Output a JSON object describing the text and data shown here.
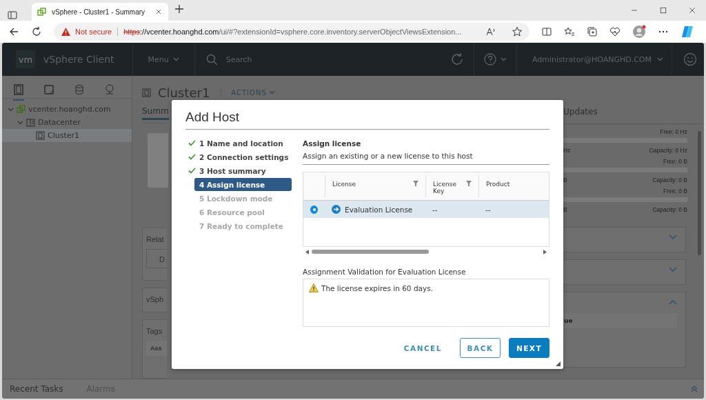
{
  "browser": {
    "tab": {
      "title": "vSphere - Cluster1 - Summary"
    },
    "security": "Not secure",
    "url": {
      "scheme": "https",
      "host": "://vcenter.hoanghd.com",
      "path": "/ui/#?extensionId=vsphere.core.inventory.serverObjectViewsExtension..."
    }
  },
  "header": {
    "logo": "vm",
    "product": "vSphere Client",
    "menu": "Menu",
    "search_placeholder": "Search",
    "user": "Administrator@HOANGHD.COM"
  },
  "nav_icons": [
    {
      "kind": "hosts",
      "selected": true
    },
    {
      "kind": "vms",
      "selected": false
    },
    {
      "kind": "storage",
      "selected": false
    },
    {
      "kind": "network",
      "selected": false
    }
  ],
  "tree": [
    {
      "label": "vcenter.hoanghd.com",
      "kind": "vcenter",
      "expanded": true,
      "selected": false,
      "children": [
        {
          "label": "Datacenter",
          "kind": "datacenter",
          "expanded": true,
          "selected": false,
          "children": [
            {
              "label": "Cluster1",
              "kind": "cluster",
              "selected": true
            }
          ]
        }
      ]
    }
  ],
  "page": {
    "title": "Cluster1",
    "actions": "ACTIONS",
    "tabs": [
      {
        "label": "Summ",
        "selected": true
      },
      {
        "label": "Updates",
        "selected": false
      }
    ],
    "left_panels": [
      {
        "title": "Relat",
        "button": "D"
      },
      {
        "title": "vSph"
      },
      {
        "title": "Tags",
        "column": "Ass"
      }
    ],
    "resources": [
      {
        "free": "Free: 0 Hz",
        "fragment": "Hz",
        "capacity": "Capacity: 0 Hz"
      },
      {
        "free": "Free: 0 B",
        "fragment": "B",
        "capacity": "Capacity: 0 B"
      },
      {
        "free": "Free: 0 B",
        "fragment": "B",
        "capacity": "Capacity: 0 B"
      }
    ],
    "right_panels": [
      {
        "expanded": false
      },
      {
        "expanded": false
      },
      {
        "expanded": true,
        "column": "ue"
      }
    ]
  },
  "bottom_tabs": [
    "Recent Tasks",
    "Alarms"
  ],
  "dialog": {
    "title": "Add Host",
    "steps": [
      {
        "label": "1 Name and location",
        "completed": true,
        "selected": false,
        "disabled": false
      },
      {
        "label": "2 Connection settings",
        "completed": true,
        "selected": false,
        "disabled": false
      },
      {
        "label": "3 Host summary",
        "completed": true,
        "selected": false,
        "disabled": false
      },
      {
        "label": "4 Assign license",
        "completed": false,
        "selected": true,
        "disabled": false
      },
      {
        "label": "5 Lockdown mode",
        "completed": false,
        "selected": false,
        "disabled": true
      },
      {
        "label": "6 Resource pool",
        "completed": false,
        "selected": false,
        "disabled": true
      },
      {
        "label": "7 Ready to complete",
        "completed": false,
        "selected": false,
        "disabled": true
      }
    ],
    "section_title": "Assign license",
    "section_text": "Assign an existing or a new license to this host",
    "license_table": {
      "columns": [
        {
          "label": "License",
          "filter": true
        },
        {
          "label": "License Key",
          "filter": true
        },
        {
          "label": "Product",
          "filter": false
        }
      ],
      "rows": [
        {
          "selected": true,
          "cells": [
            "Evaluation License",
            "--",
            "--"
          ]
        }
      ]
    },
    "validation_title": "Assignment Validation for Evaluation License",
    "validation_message": "The license expires in 60 days.",
    "buttons": [
      {
        "label": "CANCEL",
        "kind": "flat"
      },
      {
        "label": "BACK",
        "kind": "outline"
      },
      {
        "label": "NEXT",
        "kind": "primary"
      }
    ]
  }
}
